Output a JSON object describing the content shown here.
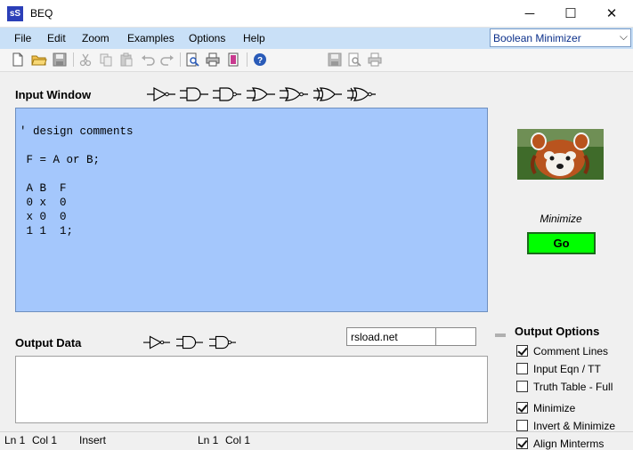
{
  "window": {
    "app_icon_text": "sS",
    "title": "BEQ",
    "minimize_glyph": "─",
    "maximize_glyph": "☐",
    "close_glyph": "✕"
  },
  "menu": {
    "items": [
      {
        "label": "File"
      },
      {
        "label": "Edit"
      },
      {
        "label": "Zoom"
      },
      {
        "label": "Examples"
      },
      {
        "label": "Options"
      },
      {
        "label": "Help"
      }
    ],
    "mode_select": {
      "value": "Boolean Minimizer"
    }
  },
  "toolbar": {
    "icons": [
      "new-file-icon",
      "open-folder-icon",
      "save-icon",
      "cut-icon",
      "copy-icon",
      "paste-icon",
      "undo-icon",
      "redo-icon",
      "print-preview-icon",
      "print-icon",
      "page-setup-icon",
      "help-icon",
      "save-output-icon",
      "output-preview-icon",
      "print-output-icon"
    ]
  },
  "input_window": {
    "label": "Input Window",
    "gates": [
      "not-gate-icon",
      "and-gate-icon",
      "nand-gate-icon",
      "or-gate-icon",
      "nor-gate-icon",
      "xor-gate-icon",
      "xnor-gate-icon"
    ],
    "text": "' design comments\n\n F = A or B;\n\n A B  F\n 0 x  0\n x 0  0\n 1 1  1;"
  },
  "right_panel": {
    "image": "red-panda-image",
    "minimize_label": "Minimize",
    "go_label": "Go"
  },
  "output_data": {
    "label": "Output Data",
    "gates": [
      "not-gate-icon",
      "and-gate-icon",
      "nand-gate-icon"
    ],
    "site_text": "rsload.net",
    "site_extra": ""
  },
  "output_options": {
    "title": "Output Options",
    "options": [
      {
        "label": "Comment Lines",
        "checked": true
      },
      {
        "label": "Input Eqn / TT",
        "checked": false
      },
      {
        "label": "Truth Table - Full",
        "checked": false
      },
      {
        "label": "Minimize",
        "checked": true
      },
      {
        "label": "Invert & Minimize",
        "checked": false
      },
      {
        "label": "Align Minterms",
        "checked": true
      }
    ]
  },
  "status": {
    "ln1": "Ln 1",
    "col1": "Col 1",
    "mode": "Insert",
    "ln2": "Ln 1",
    "col2": "Col 1"
  },
  "colors": {
    "menu_bar": "#c9e0f7",
    "input_bg": "#a4c7fc",
    "go_button": "#00ff00",
    "app_icon": "#2b3fb8"
  }
}
